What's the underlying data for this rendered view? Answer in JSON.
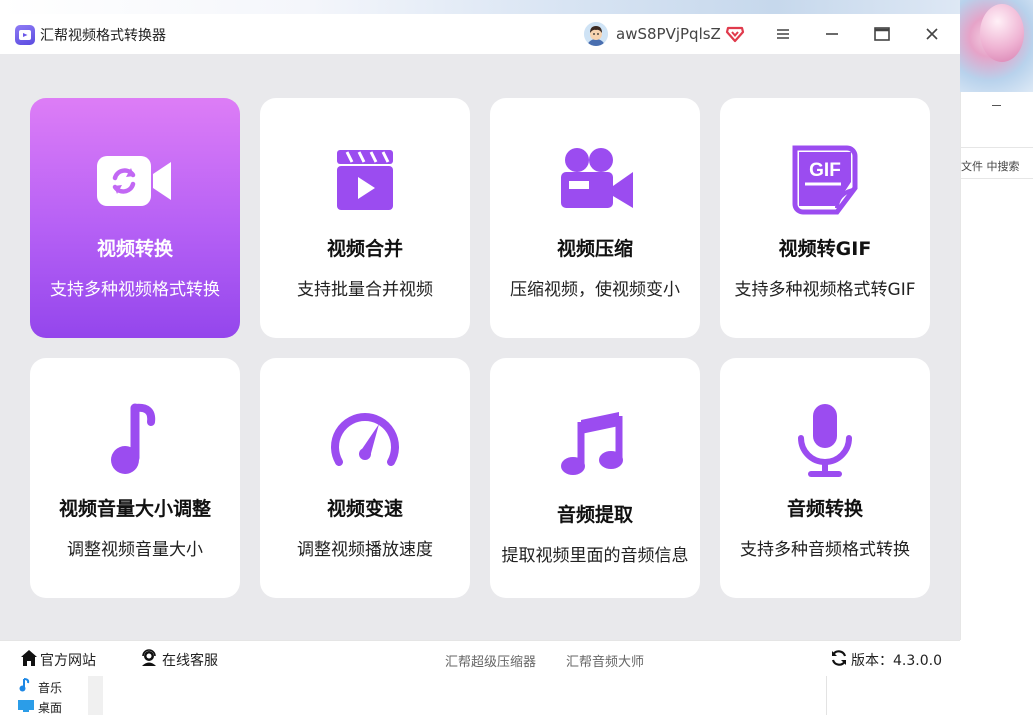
{
  "window": {
    "title": "汇帮视频格式转换器",
    "username": "awS8PVjPqlsZ"
  },
  "accent_color": "#a855f7",
  "cards": [
    {
      "title": "视频转换",
      "subtitle": "支持多种视频格式转换",
      "icon": "video-convert-icon",
      "active": true
    },
    {
      "title": "视频合并",
      "subtitle": "支持批量合并视频",
      "icon": "clapperboard-icon"
    },
    {
      "title": "视频压缩",
      "subtitle": "压缩视频，使视频变小",
      "icon": "video-camera-icon"
    },
    {
      "title": "视频转GIF",
      "subtitle": "支持多种视频格式转GIF",
      "icon": "gif-file-icon"
    },
    {
      "title": "视频音量大小调整",
      "subtitle": "调整视频音量大小",
      "icon": "music-note-icon"
    },
    {
      "title": "视频变速",
      "subtitle": "调整视频播放速度",
      "icon": "speedometer-icon"
    },
    {
      "title": "音频提取",
      "subtitle": "提取视频里面的音频信息",
      "icon": "double-music-note-icon"
    },
    {
      "title": "音频转换",
      "subtitle": "支持多种音频格式转换",
      "icon": "microphone-icon"
    }
  ],
  "gif_label": "GIF",
  "footer": {
    "official_site": "官方网站",
    "online_service": "在线客服",
    "link1": "汇帮超级压缩器",
    "link2": "汇帮音频大师",
    "version_label": "版本：4.3.0.0"
  },
  "background": {
    "search_text": "文件 中搜索",
    "explorer_items": [
      "音乐",
      "桌面"
    ]
  }
}
